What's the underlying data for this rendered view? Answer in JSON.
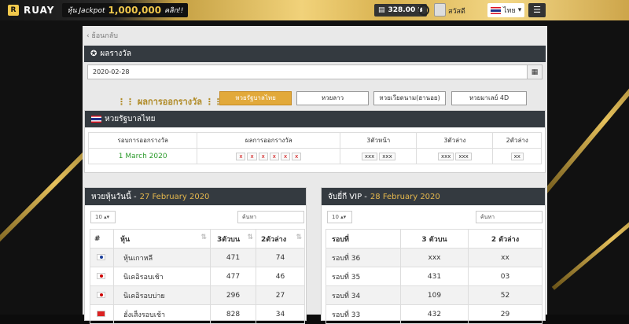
{
  "brand": {
    "logo": "RUAY",
    "jackpot_label": "หุ้น Jackpot",
    "jackpot_amount": "1,000,000",
    "jackpot_cta": "คลิก!!"
  },
  "header": {
    "credit": "328.00 ฿",
    "user": "สวัสดี",
    "language": "ไทย",
    "menu_icon": "hamburger-icon"
  },
  "nav": {
    "back_label": "ย้อนกลับ"
  },
  "results": {
    "title": "ผลรางวัล",
    "date": "2020-02-28",
    "subtitle": "ผลการออกรางวัล",
    "tabs": [
      "หวยรัฐบาลไทย",
      "หวยลาว",
      "หวยเวียดนาม(ฮานอย)",
      "หวยมาเลย์ 4D"
    ]
  },
  "thai_lottery": {
    "title": "หวยรัฐบาลไทย",
    "columns": [
      "รอบการออกรางวัล",
      "ผลการออกรางวัล",
      "3ตัวหน้า",
      "3ตัวล่าง",
      "2ตัวล่าง"
    ],
    "round": "1 March 2020",
    "result_digits": [
      "x",
      "x",
      "x",
      "x",
      "x",
      "x"
    ],
    "front3": [
      "xxx",
      "xxx"
    ],
    "back3": [
      "xxx",
      "xxx"
    ],
    "back2": "xx"
  },
  "stock_lottery": {
    "title": "หวยหุ้นวันนี้ - ",
    "date": "27 February 2020",
    "page_size": "10",
    "search_placeholder": "ค้นหา",
    "columns": [
      "#",
      "หุ้น",
      "3ตัวบน",
      "2ตัวล่าง"
    ],
    "rows": [
      {
        "name": "หุ้นเกาหลี",
        "three": "471",
        "two": "74"
      },
      {
        "name": "นิเคอิรอบเช้า",
        "three": "477",
        "two": "46"
      },
      {
        "name": "นิเคอิรอบบ่าย",
        "three": "296",
        "two": "27"
      },
      {
        "name": "ฮั่งเส็งรอบเช้า",
        "three": "828",
        "two": "34"
      }
    ]
  },
  "vip_lottery": {
    "title": "จับยี่กี VIP - ",
    "date": "28 February 2020",
    "page_size": "10",
    "search_placeholder": "ค้นหา",
    "columns": [
      "รอบที่",
      "3 ตัวบน",
      "2 ตัวล่าง"
    ],
    "rows": [
      {
        "round": "รอบที่ 36",
        "three": "xxx",
        "two": "xx"
      },
      {
        "round": "รอบที่ 35",
        "three": "431",
        "two": "03"
      },
      {
        "round": "รอบที่ 34",
        "three": "109",
        "two": "52"
      },
      {
        "round": "รอบที่ 33",
        "three": "432",
        "two": "29"
      }
    ]
  },
  "colors": {
    "gold": "#e6b84d",
    "dark": "#343a40",
    "active_tab": "#e2a93a"
  }
}
